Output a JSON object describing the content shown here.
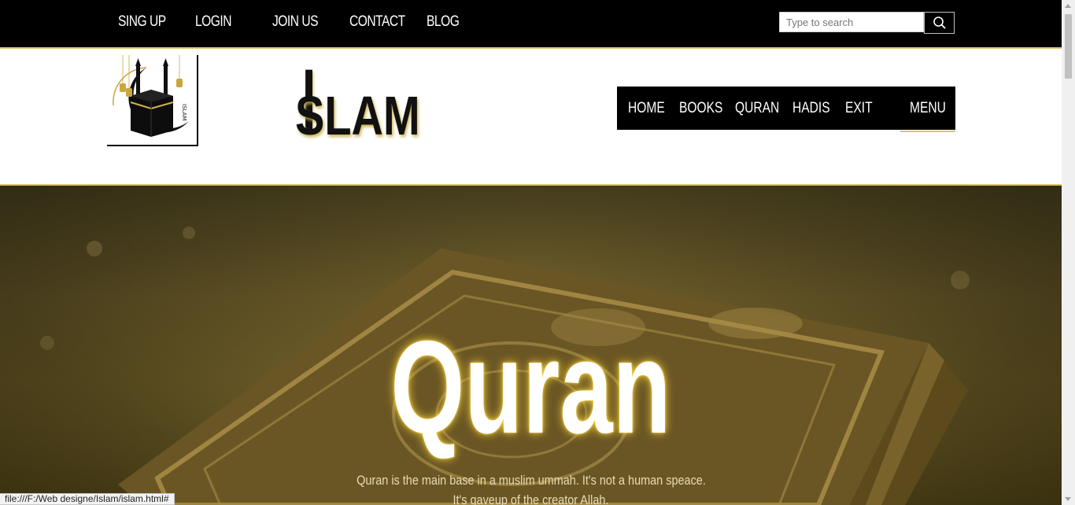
{
  "topbar": {
    "links": [
      "SING UP",
      "LOGIN",
      "JOIN US",
      "CONTACT",
      "BLOG"
    ],
    "search_placeholder": "Type to search",
    "search_icon": "search-icon"
  },
  "header": {
    "logo_icon": "kaaba-crescent-logo",
    "logo_text": "ISLAM",
    "brand_cap": "I",
    "brand_rest": "SLAM",
    "nav": [
      "HOME",
      "BOOKS",
      "QURAN",
      "HADIS",
      "EXIT"
    ],
    "menu_label": "MENU"
  },
  "hero": {
    "title": "Quran",
    "line1": "Quran is the main base in a muslim ummah. It's not a human speace.",
    "line2": "It's gaveup of the creator Allah."
  },
  "status_url": "file:///F:/Web designe/Islam/islam.html#",
  "colors": {
    "accent": "#d8c66a",
    "bar": "#000000"
  }
}
